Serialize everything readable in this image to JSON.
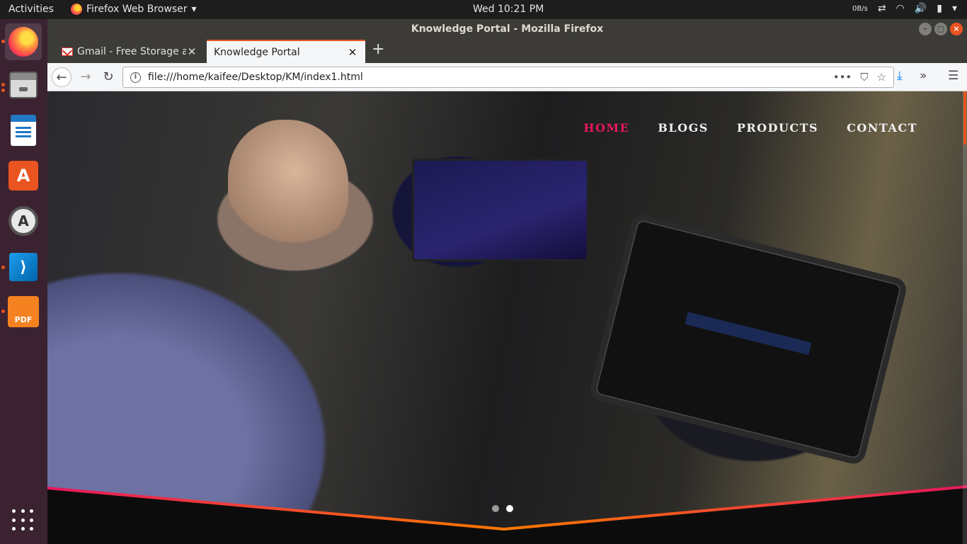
{
  "topbar": {
    "activities": "Activities",
    "app_menu": "Firefox Web Browser",
    "clock": "Wed 10:21 PM",
    "net_speed": "0B/s"
  },
  "dock": {
    "items": [
      {
        "name": "firefox-icon"
      },
      {
        "name": "files-icon"
      },
      {
        "name": "libreoffice-writer-icon"
      },
      {
        "name": "ubuntu-software-icon"
      },
      {
        "name": "software-updater-icon"
      },
      {
        "name": "vscode-icon"
      },
      {
        "name": "pdf-editor-icon",
        "label": "PDF"
      }
    ]
  },
  "window": {
    "title": "Knowledge Portal - Mozilla Firefox"
  },
  "tabs": [
    {
      "label": "Gmail - Free Storage and",
      "active": false
    },
    {
      "label": "Knowledge Portal",
      "active": true
    }
  ],
  "urlbar": {
    "url": "file:///home/kaifee/Desktop/KM/index1.html"
  },
  "site": {
    "nav": [
      {
        "label": "HOME",
        "current": true
      },
      {
        "label": "BLOGS",
        "current": false
      },
      {
        "label": "PRODUCTS",
        "current": false
      },
      {
        "label": "CONTACT",
        "current": false
      }
    ],
    "slider": {
      "slides": 2,
      "active": 2
    }
  },
  "colors": {
    "accent": "#e95420",
    "nav_active": "#e8175d",
    "wave_start": "#e8175d",
    "wave_end": "#ff7a00"
  }
}
